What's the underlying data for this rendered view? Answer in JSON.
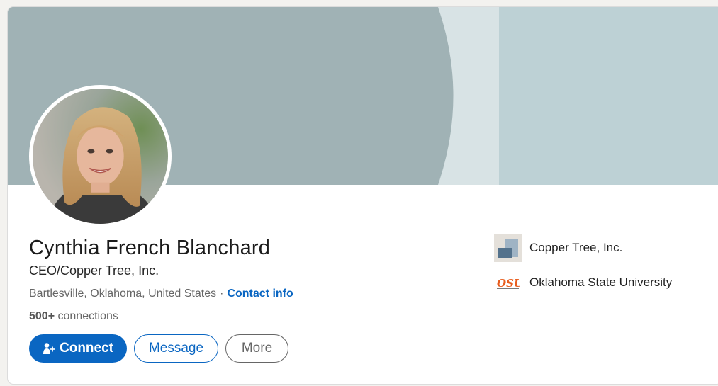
{
  "profile": {
    "name": "Cynthia French Blanchard",
    "headline": "CEO/Copper Tree, Inc.",
    "location": "Bartlesville, Oklahoma, United States",
    "separator": "·",
    "contact_info_label": "Contact info",
    "connections_count": "500+",
    "connections_label": "connections"
  },
  "actions": {
    "connect_label": "Connect",
    "message_label": "Message",
    "more_label": "More"
  },
  "organizations": [
    {
      "name": "Copper Tree, Inc.",
      "icon": "company-logo"
    },
    {
      "name": "Oklahoma State University",
      "icon": "osu-logo"
    }
  ],
  "colors": {
    "primary": "#0a66c2",
    "banner": "#a0b2b5",
    "banner_light": "#d8e3e5",
    "banner_panel": "#bdd1d5",
    "osu_orange": "#e85d1e"
  }
}
